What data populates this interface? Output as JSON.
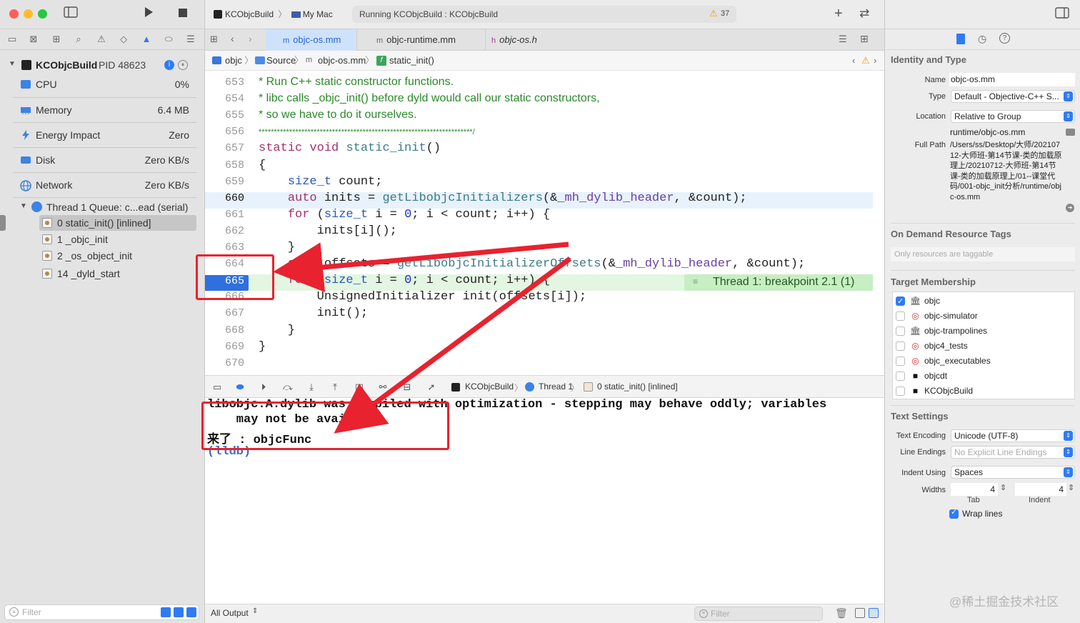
{
  "window": {
    "scheme_name": "KCObjcBuild",
    "destination": "My Mac",
    "activity_status": "Running KCObjcBuild : KCObjcBuild",
    "warning_count": "37"
  },
  "navigator": {
    "process": {
      "name": "KCObjcBuild",
      "pid": "PID 48623"
    },
    "gauges": [
      {
        "label": "CPU",
        "value": "0%",
        "icon": "cpu-icon"
      },
      {
        "label": "Memory",
        "value": "6.4 MB",
        "icon": "memory-icon"
      },
      {
        "label": "Energy Impact",
        "value": "Zero",
        "icon": "energy-icon"
      },
      {
        "label": "Disk",
        "value": "Zero KB/s",
        "icon": "disk-icon"
      },
      {
        "label": "Network",
        "value": "Zero KB/s",
        "icon": "network-icon"
      }
    ],
    "thread": "Thread 1 Queue: c...ead (serial)",
    "frames": [
      "0 static_init() [inlined]",
      "1 _objc_init",
      "2 _os_object_init",
      "14 _dyld_start"
    ],
    "filter_placeholder": "Filter"
  },
  "tabs": [
    {
      "label": "objc-os.mm",
      "active": true
    },
    {
      "label": "objc-runtime.mm",
      "active": false
    },
    {
      "label": "objc-os.h",
      "active": false
    }
  ],
  "jumpbar": {
    "crumbs": [
      "objc",
      "Source",
      "objc-os.mm",
      "static_init()"
    ]
  },
  "editor": {
    "current_line": "660",
    "breakpoint_line": "665",
    "breakpoint_label": "Thread 1: breakpoint 2.1 (1)",
    "lines": [
      {
        "n": "653",
        "t": "* Run C++ static constructor functions."
      },
      {
        "n": "654",
        "t": "* libc calls _objc_init() before dyld would call our static constructors,"
      },
      {
        "n": "655",
        "t": "* so we have to do it ourselves."
      },
      {
        "n": "656",
        "t": "**********************************************************************/"
      },
      {
        "n": "657",
        "t": "static void static_init()"
      },
      {
        "n": "658",
        "t": "{"
      },
      {
        "n": "659",
        "t": "    size_t count;"
      },
      {
        "n": "660",
        "t": "    auto inits = getLibobjcInitializers(&_mh_dylib_header, &count);"
      },
      {
        "n": "661",
        "t": "    for (size_t i = 0; i < count; i++) {"
      },
      {
        "n": "662",
        "t": "        inits[i]();"
      },
      {
        "n": "663",
        "t": "    }"
      },
      {
        "n": "664",
        "t": "    auto offsets = getLibobjcInitializerOffsets(&_mh_dylib_header, &count);"
      },
      {
        "n": "665",
        "t": "    for (size_t i = 0; i < count; i++) {"
      },
      {
        "n": "666",
        "t": "        UnsignedInitializer init(offsets[i]);"
      },
      {
        "n": "667",
        "t": "        init();"
      },
      {
        "n": "668",
        "t": "    }"
      },
      {
        "n": "669",
        "t": "}"
      },
      {
        "n": "670",
        "t": ""
      }
    ]
  },
  "debugbar": {
    "crumbs": [
      "KCObjcBuild",
      "Thread 1",
      "0 static_init() [inlined]"
    ]
  },
  "console": {
    "lines": [
      "libobjc.A.dylib was compiled with optimization - stepping may behave oddly; variables",
      "    may not be available.",
      "来了 : objcFunc",
      "(lldb)"
    ],
    "output_selector": "All Output",
    "filter_placeholder": "Filter"
  },
  "inspector": {
    "identity": {
      "title": "Identity and Type",
      "name_label": "Name",
      "name": "objc-os.mm",
      "type_label": "Type",
      "type": "Default - Objective-C++ S...",
      "location_label": "Location",
      "location": "Relative to Group",
      "relative_path": "runtime/objc-os.mm",
      "full_path_label": "Full Path",
      "full_path": "/Users/ss/Desktop/大师/20210712-大师班-第14节课-类的加载原理上/20210712-大师班-第14节课-类的加载原理上/01--课堂代码/001-objc_init分析/runtime/objc-os.mm"
    },
    "on_demand": {
      "title": "On Demand Resource Tags",
      "placeholder": "Only resources are taggable"
    },
    "target_membership": {
      "title": "Target Membership",
      "targets": [
        {
          "name": "objc",
          "checked": true,
          "icon": "library-icon"
        },
        {
          "name": "objc-simulator",
          "checked": false,
          "icon": "target-icon"
        },
        {
          "name": "objc-trampolines",
          "checked": false,
          "icon": "library-icon"
        },
        {
          "name": "objc4_tests",
          "checked": false,
          "icon": "target-icon"
        },
        {
          "name": "objc_executables",
          "checked": false,
          "icon": "target-icon"
        },
        {
          "name": "objcdt",
          "checked": false,
          "icon": "terminal-icon"
        },
        {
          "name": "KCObjcBuild",
          "checked": false,
          "icon": "terminal-icon"
        }
      ]
    },
    "text_settings": {
      "title": "Text Settings",
      "encoding_label": "Text Encoding",
      "encoding": "Unicode (UTF-8)",
      "line_endings_label": "Line Endings",
      "line_endings": "No Explicit Line Endings",
      "indent_label": "Indent Using",
      "indent": "Spaces",
      "widths_label": "Widths",
      "tab_width": "4",
      "indent_width": "4",
      "tab_caption": "Tab",
      "indent_caption": "Indent",
      "wrap_label": "Wrap lines",
      "wrap": true
    }
  },
  "watermark": "@稀土掘金技术社区",
  "colors": {
    "accent": "#2f7bf6",
    "breakpoint": "#2f6fe0",
    "annotation_red": "#e8222f",
    "current_line_bg": "#e8f2fd",
    "breakpoint_line_bg": "#e3f6e1",
    "comment_green": "#2a8a2a"
  }
}
